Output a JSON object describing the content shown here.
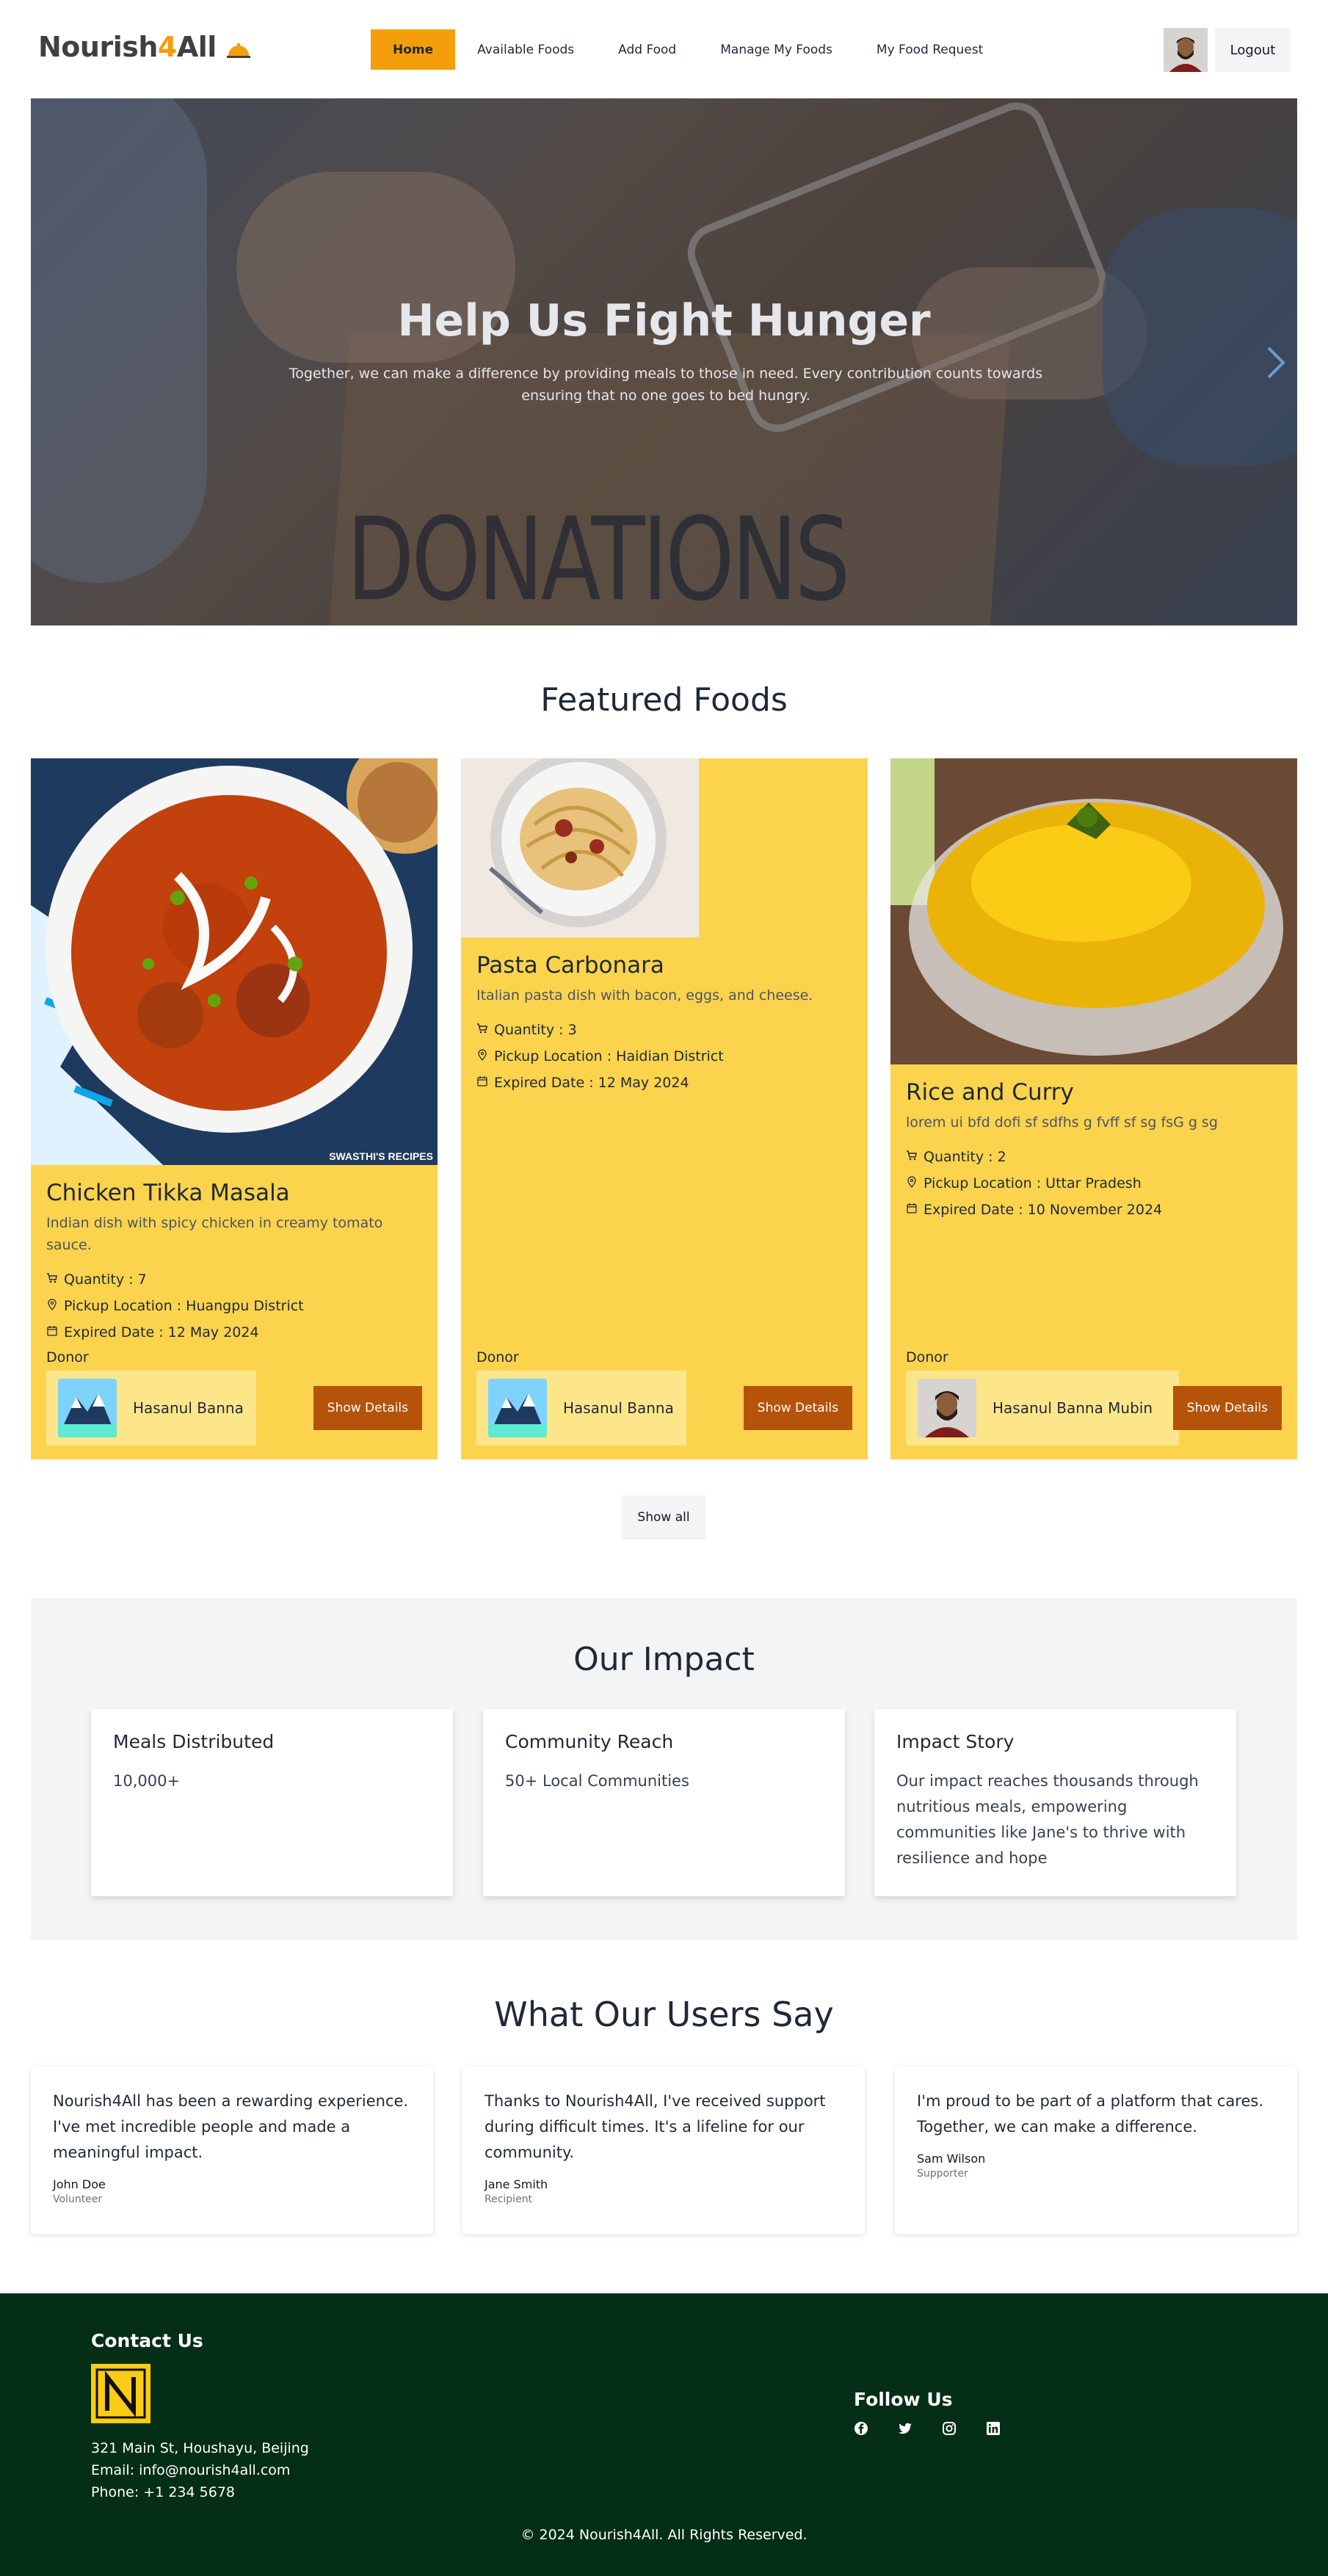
{
  "navbar": {
    "brand_prefix": "Nourish",
    "brand_number": "4",
    "brand_suffix": "All",
    "brand_icon": "food-dish-icon",
    "links": [
      "Home",
      "Available Foods",
      "Add Food",
      "Manage My Foods",
      "My Food Request"
    ],
    "active_link": "Home",
    "logout_label": "Logout"
  },
  "hero": {
    "title": "Help Us Fight Hunger",
    "subtitle": "Together, we can make a difference by providing meals to those in need. Every contribution counts towards ensuring that no one goes to bed hungry.",
    "next_icon": "chevron-right-icon"
  },
  "featured": {
    "title": "Featured Foods",
    "donor_label": "Donor",
    "quantity_label": "Quantity : ",
    "location_label": "Pickup Location : ",
    "expired_label": "Expired Date : ",
    "details_label": "Show Details",
    "foods": [
      {
        "name": "Chicken Tikka Masala",
        "description": "Indian dish with spicy chicken in creamy tomato sauce.",
        "quantity": "7",
        "location": "Huangpu District",
        "expired": "12 May 2024",
        "donor": "Hasanul Banna",
        "image_watermark": "SWASTHI'S RECIPES"
      },
      {
        "name": "Pasta Carbonara",
        "description": "Italian pasta dish with bacon, eggs, and cheese.",
        "quantity": "3",
        "location": "Haidian District",
        "expired": "12 May 2024",
        "donor": "Hasanul Banna"
      },
      {
        "name": "Rice and Curry",
        "description": "lorem ui bfd dofi sf sdfhs g fvff sf sg fsG g sg",
        "quantity": "2",
        "location": "Uttar Pradesh",
        "expired": "10 November 2024",
        "donor": "Hasanul Banna Mubin"
      }
    ],
    "show_all_label": "Show all"
  },
  "impact": {
    "title": "Our Impact",
    "cards": [
      {
        "title": "Meals Distributed",
        "text": "10,000+"
      },
      {
        "title": "Community Reach",
        "text": "50+ Local Communities"
      },
      {
        "title": "Impact Story",
        "text": "Our impact reaches thousands through nutritious meals, empowering communities like Jane's to thrive with resilience and hope"
      }
    ]
  },
  "testimonials": {
    "title": "What Our Users Say",
    "items": [
      {
        "quote": "Nourish4All has been a rewarding experience. I've met incredible people and made a meaningful impact.",
        "name": "John Doe",
        "role": "Volunteer"
      },
      {
        "quote": "Thanks to Nourish4All, I've received support during difficult times. It's a lifeline for our community.",
        "name": "Jane Smith",
        "role": "Recipient"
      },
      {
        "quote": "I'm proud to be part of a platform that cares. Together, we can make a difference.",
        "name": "Sam Wilson",
        "role": "Supporter"
      }
    ]
  },
  "footer": {
    "contact_title": "Contact Us",
    "address": "321 Main St, Houshayu, Beijing",
    "email": "Email: info@nourish4all.com",
    "phone": "Phone: +1 234 5678",
    "follow_title": "Follow Us",
    "social_icons": [
      "facebook-icon",
      "twitter-icon",
      "instagram-icon",
      "linkedin-icon"
    ],
    "copyright": "© 2024 Nourish4All. All Rights Reserved.",
    "colors": {
      "footer_bg": "#052e16",
      "accent": "#f59e0b",
      "card_bg": "#fcd34d",
      "button": "#b45309"
    }
  }
}
